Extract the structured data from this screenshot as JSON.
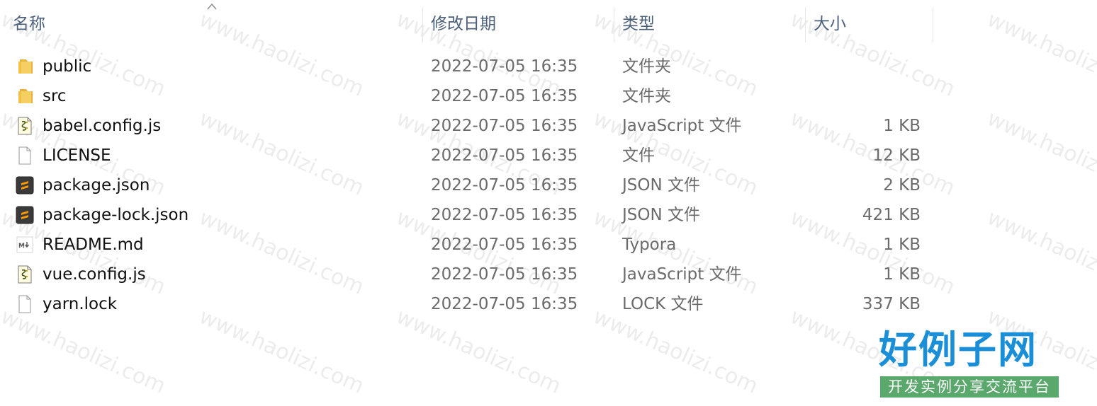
{
  "columns": {
    "name": "名称",
    "date": "修改日期",
    "type": "类型",
    "size": "大小"
  },
  "files": [
    {
      "name": "public",
      "modified": "2022-07-05 16:35",
      "type": "文件夹",
      "size": "",
      "icon": "folder-icon"
    },
    {
      "name": "src",
      "modified": "2022-07-05 16:35",
      "type": "文件夹",
      "size": "",
      "icon": "folder-icon"
    },
    {
      "name": "babel.config.js",
      "modified": "2022-07-05 16:35",
      "type": "JavaScript 文件",
      "size": "1 KB",
      "icon": "script-file-icon"
    },
    {
      "name": "LICENSE",
      "modified": "2022-07-05 16:35",
      "type": "文件",
      "size": "12 KB",
      "icon": "blank-file-icon"
    },
    {
      "name": "package.json",
      "modified": "2022-07-05 16:35",
      "type": "JSON 文件",
      "size": "2 KB",
      "icon": "sublime-file-icon"
    },
    {
      "name": "package-lock.json",
      "modified": "2022-07-05 16:35",
      "type": "JSON 文件",
      "size": "421 KB",
      "icon": "sublime-file-icon"
    },
    {
      "name": "README.md",
      "modified": "2022-07-05 16:35",
      "type": "Typora",
      "size": "1 KB",
      "icon": "markdown-file-icon"
    },
    {
      "name": "vue.config.js",
      "modified": "2022-07-05 16:35",
      "type": "JavaScript 文件",
      "size": "1 KB",
      "icon": "script-file-icon"
    },
    {
      "name": "yarn.lock",
      "modified": "2022-07-05 16:35",
      "type": "LOCK 文件",
      "size": "337 KB",
      "icon": "blank-file-icon"
    }
  ],
  "watermark": "www.haolizi.com",
  "brand": {
    "title": "好例子网",
    "subtitle": "开发实例分享交流平台"
  },
  "colors": {
    "header_text": "#4c607a",
    "secondary_text": "#6b6b6b",
    "folder": "#f2c14e",
    "brand_blue": "#1a8fd8",
    "brand_green": "#5aa86b"
  }
}
